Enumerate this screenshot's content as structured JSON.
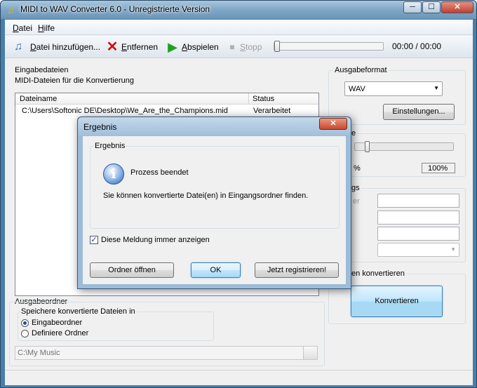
{
  "window": {
    "title": "MIDI to WAV Converter 6.0 - Unregistrierte Version",
    "min_glyph": "─",
    "max_glyph": "☐",
    "close_glyph": "✕"
  },
  "menu": {
    "datei": "Datei",
    "hilfe": "Hilfe"
  },
  "toolbar": {
    "add_label": "Datei hinzufügen...",
    "remove_label": "Entfernen",
    "play_label": "Abspielen",
    "stop_label": "Stopp",
    "time": "00:00 / 00:00",
    "seek_progress": 0
  },
  "input_files": {
    "title": "Eingabedateien",
    "subtitle": "MIDI-Dateien für die Konvertierung",
    "columns": [
      "Dateiname",
      "Status"
    ],
    "rows": [
      {
        "filename": "C:\\Users\\Softonic DE\\Desktop\\We_Are_the_Champions.mid",
        "status": "Verarbeitet"
      }
    ]
  },
  "output_format": {
    "title": "Ausgabeformat",
    "selected": "WAV",
    "settings_label": "Einstellungen..."
  },
  "volume": {
    "title_fragment": "e",
    "percent_left": "%",
    "percent_value": "100%"
  },
  "tags": {
    "title_fragment": "gs",
    "label_fragment": "er"
  },
  "convert": {
    "title_fragment": "en konvertieren",
    "button_label": "Konvertieren"
  },
  "output_folder": {
    "title": "Ausgabeordner",
    "group_label": "Speichere konvertierte Dateien in",
    "option_input": "Eingabeordner",
    "option_define": "Definiere Ordner",
    "path": "C:\\My Music"
  },
  "dialog": {
    "title": "Ergebnis",
    "close_glyph": "✕",
    "group_title": "Ergebnis",
    "heading": "Prozess beendet",
    "message": "Sie können konvertierte Datei(en) in Eingangsordner finden.",
    "checkbox_label": "Diese Meldung immer anzeigen",
    "checkbox_checked": true,
    "buttons": {
      "open_folder": "Ordner öffnen",
      "ok": "OK",
      "register": "Jetzt registrieren!"
    }
  },
  "icons": {
    "app": "music-note-icon",
    "add": "add-file-icon",
    "remove": "red-x-icon",
    "play": "green-play-icon",
    "stop": "gray-stop-icon",
    "info": "info-icon"
  },
  "colors": {
    "accent": "#3c7fb1",
    "remove_red": "#d01010",
    "play_green": "#20a020"
  }
}
